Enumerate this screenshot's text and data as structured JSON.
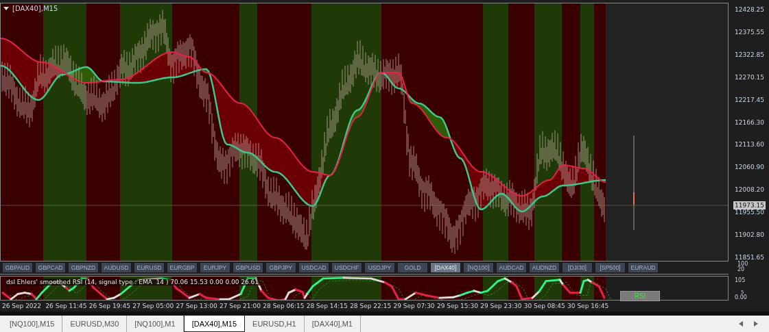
{
  "chart": {
    "title": "[DAX40],M15",
    "price_axis": [
      "12428.25",
      "12375.55",
      "12322.85",
      "12270.15",
      "12217.45",
      "12166.30",
      "12113.60",
      "12060.90",
      "12008.20",
      "11955.50",
      "11902.80",
      "11851.65"
    ],
    "current_price": "11973.15"
  },
  "symbol_buttons": [
    {
      "label": "GBPAUD",
      "selected": false
    },
    {
      "label": "GBPCAD",
      "selected": false
    },
    {
      "label": "GBPNZD",
      "selected": false
    },
    {
      "label": "AUDUSD",
      "selected": false
    },
    {
      "label": "EURUSD",
      "selected": false
    },
    {
      "label": "EURGBP",
      "selected": false
    },
    {
      "label": "EURJPY",
      "selected": false
    },
    {
      "label": "GBPUSD",
      "selected": false
    },
    {
      "label": "GBPJPY",
      "selected": false
    },
    {
      "label": "USDCAD",
      "selected": false
    },
    {
      "label": "USDCHF",
      "selected": false
    },
    {
      "label": "USDJPY",
      "selected": false
    },
    {
      "label": "GOLD",
      "selected": false
    },
    {
      "label": "[DAX40]",
      "selected": true
    },
    {
      "label": "[NQ100]",
      "selected": false
    },
    {
      "label": "AUDCAD",
      "selected": false
    },
    {
      "label": "AUDNZD",
      "selected": false
    },
    {
      "label": "[DJI30]",
      "selected": false
    },
    {
      "label": "[SP500]",
      "selected": false
    },
    {
      "label": "EURAUD",
      "selected": false
    }
  ],
  "buttons_axis": [
    "100",
    "20"
  ],
  "indicator": {
    "title": "dsl Ehlers' smoothed RSI (14, signal type : EMA  14 ) 70.06 15.53 0.00 0.00 26.61",
    "axis": [
      "105",
      "5",
      "0.00"
    ],
    "button": "RSI"
  },
  "time_axis": [
    "26 Sep 2022",
    "26 Sep 11:45",
    "26 Sep 19:45",
    "27 Sep 05:00",
    "27 Sep 13:00",
    "27 Sep 21:00",
    "28 Sep 06:15",
    "28 Sep 14:15",
    "28 Sep 22:15",
    "29 Sep 07:30",
    "29 Sep 15:30",
    "29 Sep 23:30",
    "30 Sep 08:45",
    "30 Sep 16:45"
  ],
  "tabs": [
    {
      "label": "[NQ100],M15",
      "selected": false
    },
    {
      "label": "EURUSD,M30",
      "selected": false
    },
    {
      "label": "[NQ100],M1",
      "selected": false
    },
    {
      "label": "[DAX40],M15",
      "selected": true
    },
    {
      "label": "EURUSD,H1",
      "selected": false
    },
    {
      "label": "[DAX40],M1",
      "selected": false
    }
  ]
}
